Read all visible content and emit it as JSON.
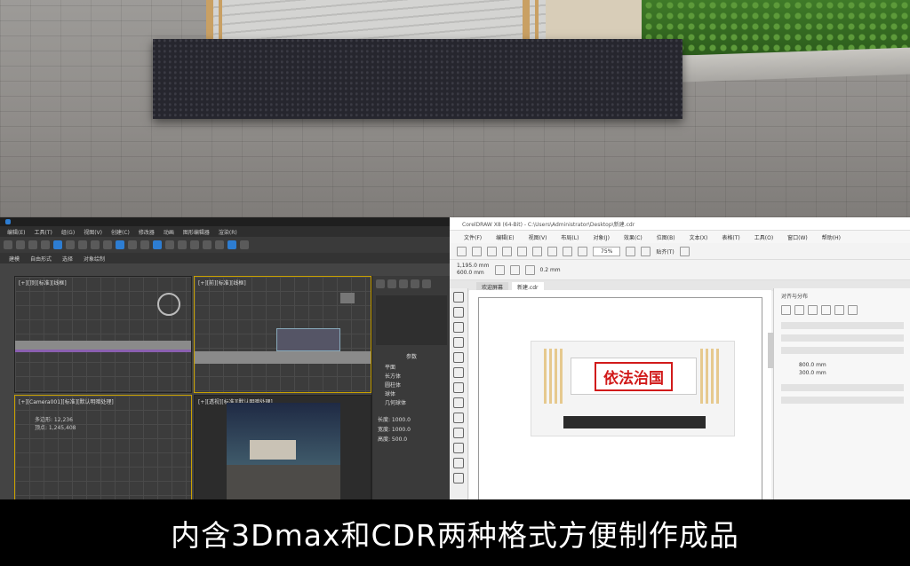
{
  "max_window": {
    "menu_items": [
      "编辑(E)",
      "工具(T)",
      "组(G)",
      "视图(V)",
      "创建(C)",
      "修改器",
      "动画",
      "图形编辑器",
      "渲染(R)"
    ],
    "viewport_labels": {
      "top": "[+][顶][标准][线框]",
      "front": "[+][前][标准][线框]",
      "left": "[+][Camera001][标准][默认明暗处理]",
      "perspective": "[+][透视][标准][默认明暗处理]"
    },
    "stats": [
      "多边形: 12,236",
      "顶点: 1,245,408"
    ],
    "command_panel": {
      "title": "参数",
      "options": [
        "平面",
        "长方体",
        "圆柱体",
        "球体",
        "几何球体"
      ],
      "fields": [
        "长度: 1000.0",
        "宽度: 1000.0",
        "高度: 500.0"
      ]
    }
  },
  "cdr_window": {
    "title": "CorelDRAW X8 (64-Bit) - C:\\Users\\Administrator\\Desktop\\新建.cdr",
    "menu_items": [
      "文件(F)",
      "编辑(E)",
      "视图(V)",
      "布局(L)",
      "对象(J)",
      "效果(C)",
      "位图(B)",
      "文本(X)",
      "表格(T)",
      "工具(O)",
      "窗口(W)",
      "帮助(H)"
    ],
    "zoom": "75%",
    "snap_label": "贴齐(T)",
    "page_size_w": "1,195.0 mm",
    "page_size_h": "600.0 mm",
    "outline": "0.2 mm",
    "tabs": [
      "欢迎屏幕",
      "新建.cdr"
    ],
    "docker_title": "对齐与分布",
    "docker_values": [
      "800.0 mm",
      "300.0 mm"
    ],
    "sign_text": "依法治国"
  },
  "caption": "内含3Dmax和CDR两种格式方便制作成品",
  "colors": {
    "caption_bg": "#000000",
    "caption_fg": "#ffffff",
    "sign_red": "#d11a1a",
    "cdr_bar": "#2b2b2b",
    "max_bg": "#444444"
  }
}
